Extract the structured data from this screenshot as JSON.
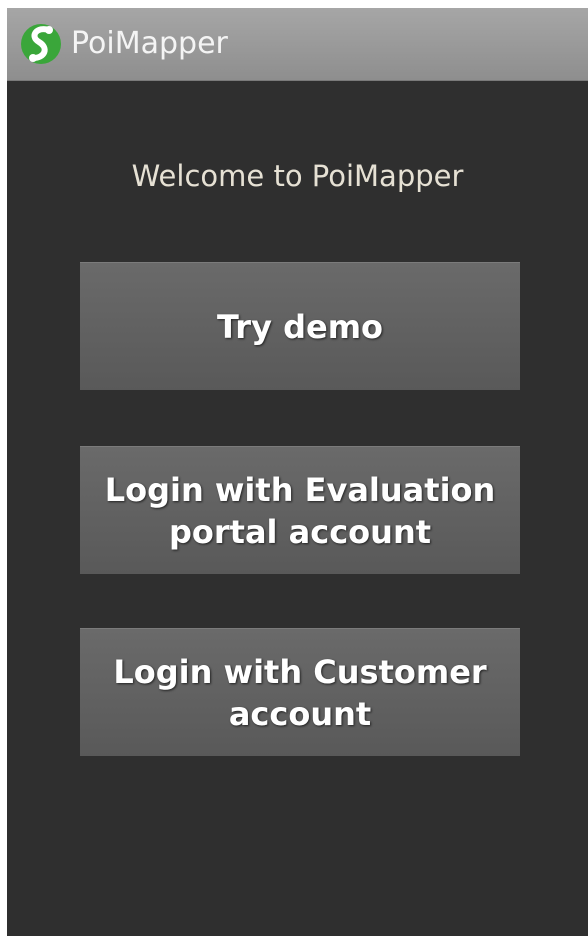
{
  "app": {
    "title": "PoiMapper",
    "icon": "poimapper-logo-icon",
    "icon_colors": [
      "#3aa63a",
      "#ffffff"
    ]
  },
  "main": {
    "welcome": "Welcome to PoiMapper",
    "buttons": [
      {
        "label": "Try demo"
      },
      {
        "label": "Login with Evaluation\nportal account"
      },
      {
        "label": "Login with Customer\naccount"
      }
    ]
  },
  "colors": {
    "background": "#2f2f2f",
    "titlebar": "#9a9a9a",
    "button": "#626262",
    "welcome_text": "#e6e1d4"
  }
}
